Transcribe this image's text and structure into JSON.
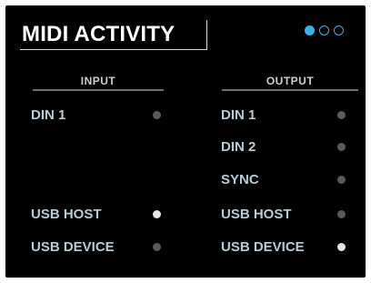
{
  "title": "MIDI ACTIVITY",
  "pager": {
    "page_count": 3,
    "active_page": 1,
    "accent": "#3ab0e6"
  },
  "input": {
    "header": "INPUT",
    "ports": [
      {
        "label": "DIN 1",
        "active": false
      },
      {
        "label": "USB HOST",
        "active": true
      },
      {
        "label": "USB DEVICE",
        "active": false
      }
    ]
  },
  "output": {
    "header": "OUTPUT",
    "ports": [
      {
        "label": "DIN 1",
        "active": false
      },
      {
        "label": "DIN 2",
        "active": false
      },
      {
        "label": "SYNC",
        "active": false
      },
      {
        "label": "USB HOST",
        "active": false
      },
      {
        "label": "USB DEVICE",
        "active": true
      }
    ]
  },
  "colors": {
    "led_on": "#e6e6e6",
    "led_off": "#5a5a5a",
    "label": "#b9cdd8"
  }
}
